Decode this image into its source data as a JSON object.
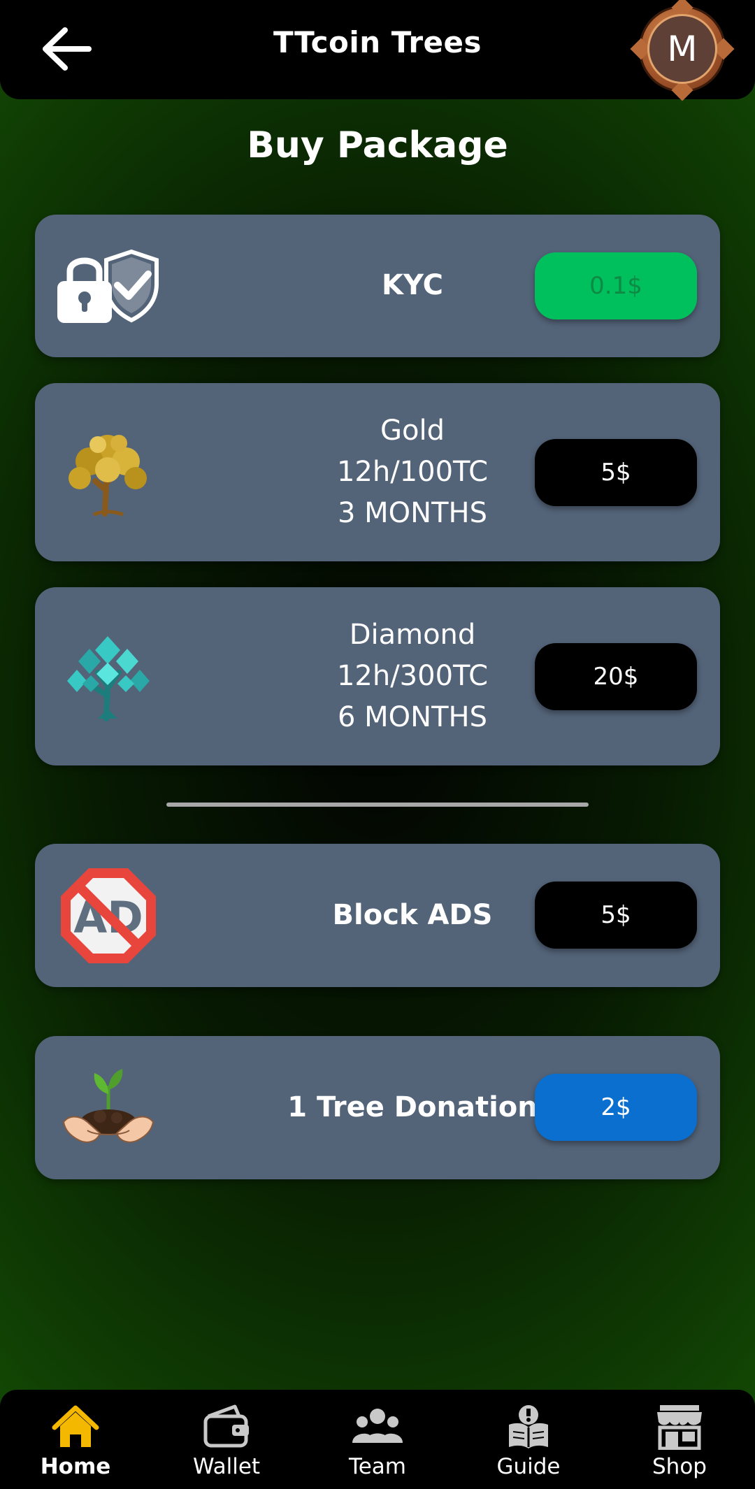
{
  "header": {
    "title": "TTcoin Trees",
    "back_icon": "arrow-left-icon",
    "avatar_letter": "M"
  },
  "page": {
    "title": "Buy Package"
  },
  "packages": [
    {
      "icon": "lock-shield-icon",
      "lines": [
        "KYC"
      ],
      "price": "0.1$",
      "price_bg": "#00c05e",
      "price_color": "#0e8a44"
    },
    {
      "icon": "gold-tree-icon",
      "lines": [
        "Gold",
        "12h/100TC",
        "3 MONTHS"
      ],
      "price": "5$",
      "price_bg": "#000000",
      "price_color": "#ffffff"
    },
    {
      "icon": "diamond-tree-icon",
      "lines": [
        "Diamond",
        "12h/300TC",
        "6 MONTHS"
      ],
      "price": "20$",
      "price_bg": "#000000",
      "price_color": "#ffffff"
    },
    {
      "icon": "no-ads-icon",
      "lines": [
        "Block ADS"
      ],
      "price": "5$",
      "price_bg": "#000000",
      "price_color": "#ffffff"
    },
    {
      "icon": "sapling-hands-icon",
      "lines": [
        "1 Tree Donation"
      ],
      "price": "2$",
      "price_bg": "#0a6fcf",
      "price_color": "#ffffff"
    }
  ],
  "nav": [
    {
      "label": "Home",
      "icon": "home-icon",
      "active": true,
      "color": "#f5b800"
    },
    {
      "label": "Wallet",
      "icon": "wallet-icon",
      "active": false,
      "color": "#c9c9c9"
    },
    {
      "label": "Team",
      "icon": "team-icon",
      "active": false,
      "color": "#c9c9c9"
    },
    {
      "label": "Guide",
      "icon": "guide-book-icon",
      "active": false,
      "color": "#c9c9c9"
    },
    {
      "label": "Shop",
      "icon": "shop-icon",
      "active": false,
      "color": "#c9c9c9"
    }
  ],
  "colors": {
    "card_bg": "#536378",
    "header_bg": "#000000",
    "background_green": "#134a04"
  }
}
